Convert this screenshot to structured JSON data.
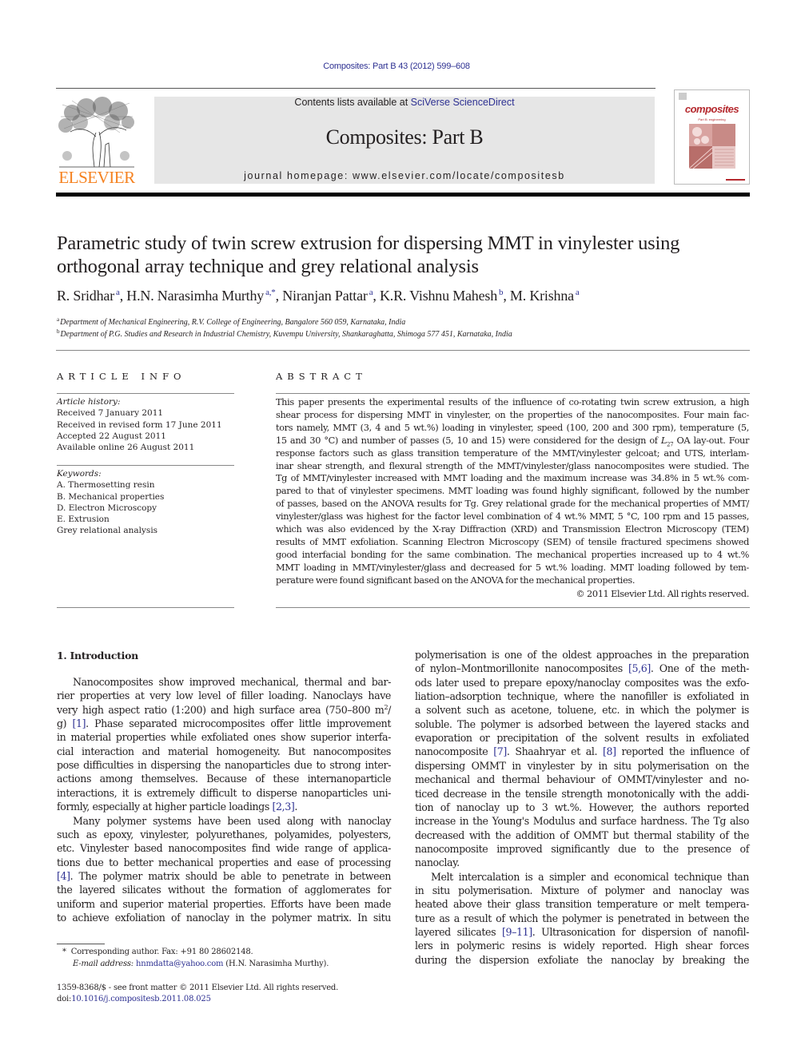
{
  "header": {
    "running_head": "Composites: Part B 43 (2012) 599–608",
    "contents_prefix": "Contents lists available at ",
    "contents_link": "SciVerse ScienceDirect",
    "journal_title": "Composites: Part B",
    "homepage": "journal homepage: www.elsevier.com/locate/compositesb",
    "publisher_logo_text": "ELSEVIER",
    "cover_word": "composites",
    "cover_subtitle": "Part B: engineering"
  },
  "article": {
    "title_lines": [
      "Parametric study of twin screw extrusion for dispersing MMT in vinylester using",
      "orthogonal array technique and grey relational analysis"
    ],
    "authors": [
      {
        "name": "R. Sridhar",
        "sup": "a"
      },
      {
        "name": "H.N. Narasimha Murthy",
        "sup": "a,*"
      },
      {
        "name": "Niranjan Pattar",
        "sup": "a"
      },
      {
        "name": "K.R. Vishnu Mahesh",
        "sup": "b"
      },
      {
        "name": "M. Krishna",
        "sup": "a"
      }
    ],
    "affiliations": [
      {
        "mark": "a",
        "text": "Department of Mechanical Engineering, R.V. College of Engineering, Bangalore 560 059, Karnataka, India"
      },
      {
        "mark": "b",
        "text": "Department of P.G. Studies and Research in Industrial Chemistry, Kuvempu University, Shankaraghatta, Shimoga 577 451, Karnataka, India"
      }
    ]
  },
  "article_info": {
    "heading": "ARTICLE INFO",
    "history_label": "Article history:",
    "history": [
      "Received 7 January 2011",
      "Received in revised form 17 June 2011",
      "Accepted 22 August 2011",
      "Available online 26 August 2011"
    ],
    "keywords_label": "Keywords:",
    "keywords": [
      "A. Thermosetting resin",
      "B. Mechanical properties",
      "D. Electron Microscopy",
      "E. Extrusion",
      "Grey relational analysis"
    ]
  },
  "abstract": {
    "heading": "ABSTRACT",
    "lines": [
      "This paper presents the experimental results of the influence of co-rotating twin screw extrusion, a high",
      "shear process for dispersing MMT in vinylester, on the properties of the nanocomposites. Four main fac-",
      "tors namely, MMT (3, 4 and 5 wt.%) loading in vinylester, speed (100, 200 and 300 rpm), temperature (5,",
      "15 and 30 °C) and number of passes (5, 10 and 15) were considered for the design of L27 OA lay-out. Four",
      "response factors such as glass transition temperature of the MMT/vinylester gelcoat; and UTS, interlam-",
      "inar shear strength, and flexural strength of the MMT/vinylester/glass nanocomposites were studied. The",
      "Tg of MMT/vinylester increased with MMT loading and the maximum increase was 34.8% in 5 wt.% com-",
      "pared to that of vinylester specimens. MMT loading was found highly significant, followed by the number",
      "of passes, based on the ANOVA results for Tg. Grey relational grade for the mechanical properties of MMT/",
      "vinylester/glass was highest for the factor level combination of 4 wt.% MMT, 5 °C, 100 rpm and 15 passes,",
      "which was also evidenced by the X-ray Diffraction (XRD) and Transmission Electron Microscopy (TEM)",
      "results of MMT exfoliation. Scanning Electron Microscopy (SEM) of tensile fractured specimens showed",
      "good interfacial bonding for the same combination. The mechanical properties increased up to 4 wt.%",
      "MMT loading in MMT/vinylester/glass and decreased for 5 wt.% loading. MMT loading followed by tem-",
      "perature were found significant based on the ANOVA for the mechanical properties."
    ],
    "copyright": "© 2011 Elsevier Ltd. All rights reserved."
  },
  "body": {
    "section_heading": "1. Introduction",
    "left_column": [
      {
        "text": "Nanocomposites show improved mechanical, thermal and bar-",
        "indent": true
      },
      {
        "text": "rier properties at very low level of filler loading. Nanoclays have"
      },
      {
        "text": "very high aspect ratio (1:200) and high surface area (750–800 m²/"
      },
      {
        "text": "g) [1]. Phase separated microcomposites offer little improvement"
      },
      {
        "text": "in material properties while exfoliated ones show superior interfa-"
      },
      {
        "text": "cial interaction and material homogeneity. But nanocomposites"
      },
      {
        "text": "pose difficulties in dispersing the nanoparticles due to strong inter-"
      },
      {
        "text": "actions among themselves. Because of these internanoparticle"
      },
      {
        "text": "interactions, it is extremely difficult to disperse nanoparticles uni-"
      },
      {
        "text": "formly, especially at higher particle loadings [2,3].",
        "last": true
      },
      {
        "text": "Many polymer systems have been used along with nanoclay",
        "indent": true
      },
      {
        "text": "such as epoxy, vinylester, polyurethanes, polyamides, polyesters,"
      },
      {
        "text": "etc. Vinylester based nanocomposites find wide range of applica-"
      },
      {
        "text": "tions due to better mechanical properties and ease of processing"
      },
      {
        "text": "[4]. The polymer matrix should be able to penetrate in between"
      },
      {
        "text": "the layered silicates without the formation of agglomerates for"
      },
      {
        "text": "uniform and superior material properties. Efforts have been made"
      },
      {
        "text": "to achieve exfoliation of nanoclay in the polymer matrix. In situ"
      }
    ],
    "right_column": [
      {
        "text": "polymerisation is one of the oldest approaches in the preparation"
      },
      {
        "text": "of nylon–Montmorillonite nanocomposites [5,6]. One of the meth-"
      },
      {
        "text": "ods later used to prepare epoxy/nanoclay composites was the exfo-"
      },
      {
        "text": "liation–adsorption technique, where the nanofiller is exfoliated in"
      },
      {
        "text": "a solvent such as acetone, toluene, etc. in which the polymer is"
      },
      {
        "text": "soluble. The polymer is adsorbed between the layered stacks and"
      },
      {
        "text": "evaporation or precipitation of the solvent results in exfoliated"
      },
      {
        "text": "nanocomposite [7]. Shaahryar et al. [8] reported the influence of"
      },
      {
        "text": "dispersing OMMT in vinylester by in situ polymerisation on the"
      },
      {
        "text": "mechanical and thermal behaviour of OMMT/vinylester and no-"
      },
      {
        "text": "ticed decrease in the tensile strength monotonically with the addi-"
      },
      {
        "text": "tion of nanoclay up to 3 wt.%. However, the authors reported"
      },
      {
        "text": "increase in the Young's Modulus and surface hardness. The Tg also"
      },
      {
        "text": "decreased with the addition of OMMT but thermal stability of the"
      },
      {
        "text": "nanocomposite improved significantly due to the presence of"
      },
      {
        "text": "nanoclay.",
        "last": true
      },
      {
        "text": "Melt intercalation is a simpler and economical technique than",
        "indent": true
      },
      {
        "text": "in situ polymerisation. Mixture of polymer and nanoclay was"
      },
      {
        "text": "heated above their glass transition temperature or melt tempera-"
      },
      {
        "text": "ture as a result of which the polymer is penetrated in between the"
      },
      {
        "text": "layered silicates [9–11]. Ultrasonication for dispersion of nanofil-"
      },
      {
        "text": "lers in polymeric resins is widely reported. High shear forces"
      },
      {
        "text": "during the dispersion exfoliate the nanoclay by breaking the"
      }
    ],
    "citations": [
      "[1]",
      "[2,3]",
      "[4]",
      "[5,6]",
      "[7]",
      "[8]",
      "[9–11]"
    ]
  },
  "footnotes": {
    "corresponding_mark": "*",
    "corresponding": "Corresponding author. Fax: +91 80 28602148.",
    "email_label": "E-mail address:",
    "email": "hnmdatta@yahoo.com",
    "email_owner": " (H.N. Narasimha Murthy).",
    "front_matter": "1359-8368/$ - see front matter © 2011 Elsevier Ltd. All rights reserved.",
    "doi_label": "doi:",
    "doi": "10.1016/j.compositesb.2011.08.025"
  },
  "colors": {
    "link": "#2e3192",
    "elsevier_orange": "#f58220",
    "banner_grey": "#e6e6e6",
    "cover_red": "#b5292e"
  }
}
